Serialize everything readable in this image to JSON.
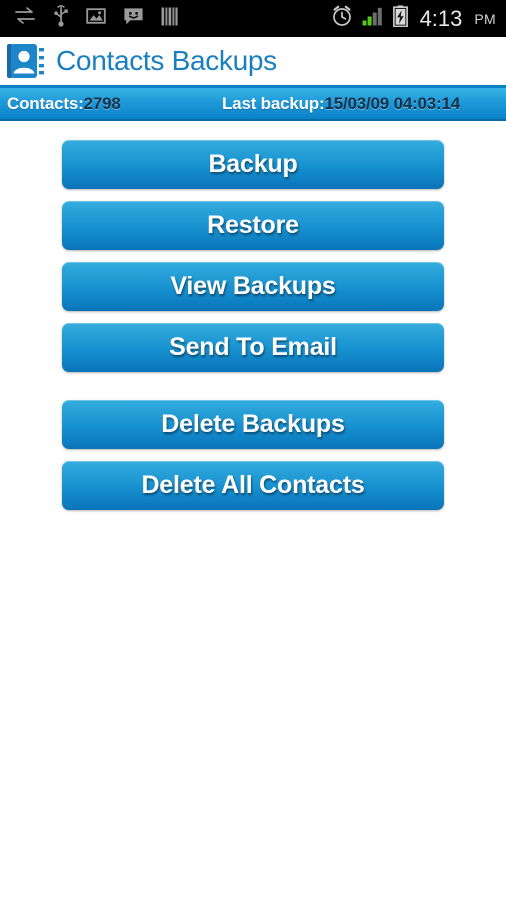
{
  "statusbar": {
    "icons_left": [
      {
        "name": "sync-transfer-icon",
        "label": "sync"
      },
      {
        "name": "usb-icon",
        "label": "usb"
      },
      {
        "name": "screenshot-image-icon",
        "label": "screenshot"
      },
      {
        "name": "sms-message-icon",
        "label": "message"
      },
      {
        "name": "vertical-bars-icon",
        "label": "bars"
      }
    ],
    "icons_right": [
      {
        "name": "alarm-clock-icon",
        "label": "alarm"
      },
      {
        "name": "signal-bars-icon",
        "label": "signal"
      },
      {
        "name": "battery-charging-icon",
        "label": "battery"
      }
    ],
    "signal_bars_active": 2,
    "signal_bars_total": 4,
    "time": "4:13",
    "ampm": "PM"
  },
  "titlebar": {
    "app_icon_name": "contacts-book-icon",
    "title": "Contacts Backups"
  },
  "infobar": {
    "contacts_label": "Contacts:",
    "contacts_value": "2798",
    "last_backup_label": "Last backup:",
    "last_backup_value": "15/03/09 04:03:14"
  },
  "buttons": [
    {
      "name": "backup-button",
      "label": "Backup"
    },
    {
      "name": "restore-button",
      "label": "Restore"
    },
    {
      "name": "view-backups-button",
      "label": "View Backups"
    },
    {
      "name": "send-to-email-button",
      "label": "Send To Email"
    },
    {
      "name": "delete-backups-button",
      "label": "Delete Backups"
    },
    {
      "name": "delete-all-contacts-button",
      "label": "Delete All Contacts"
    }
  ],
  "colors": {
    "accent_blue": "#0b7fc4",
    "title_blue": "#1a7fc1",
    "button_top": "#36adde",
    "button_bottom": "#0a73b5",
    "infobar_top": "#39b3e6",
    "infobar_bottom": "#0c82c7",
    "statusbar_bg": "#000000",
    "signal_green": "#55c61a",
    "page_bg": "#ffffff"
  }
}
